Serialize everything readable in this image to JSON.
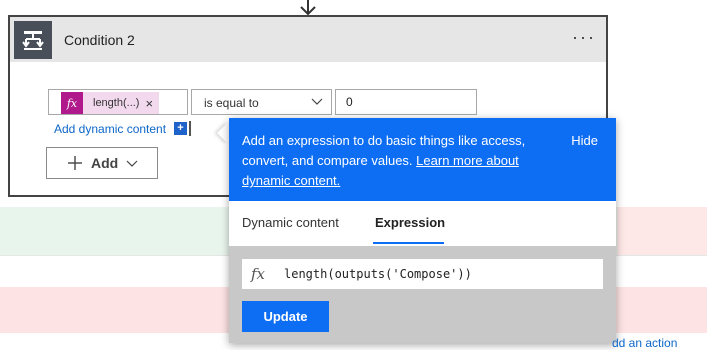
{
  "condition": {
    "title": "Condition 2",
    "menu_label": "···",
    "token_fx": "fx",
    "token_label": "length(...)",
    "token_remove": "×",
    "operator_value": "is equal to",
    "value": "0",
    "add_dynamic_label": "Add dynamic content",
    "add_dynamic_plus": "+",
    "add_button_label": "Add"
  },
  "popup": {
    "description": "Add an expression to do basic things like access, convert, and compare values.",
    "learn_more": "Learn more about dynamic content.",
    "hide_label": "Hide",
    "tabs": [
      {
        "label": "Dynamic content",
        "active": false
      },
      {
        "label": "Expression",
        "active": true
      }
    ],
    "expression_fx": "fx",
    "expression_value": "length(outputs('Compose'))",
    "update_label": "Update"
  },
  "footer": {
    "add_action_partial": "dd an action"
  },
  "colors": {
    "accent": "#0d6ef3",
    "token_bg": "#f3d9ee",
    "token_fx_bg": "#b0198b",
    "card_border": "#444444"
  },
  "icons": [
    "down-arrow-icon",
    "condition-icon",
    "more-options-icon",
    "function-icon",
    "close-icon",
    "chevron-down-icon",
    "plus-icon"
  ]
}
